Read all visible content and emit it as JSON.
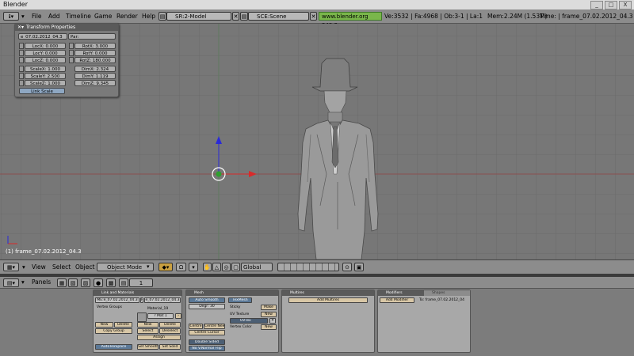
{
  "window": {
    "title": "Blender",
    "controls": [
      "_",
      "□",
      "X"
    ]
  },
  "info_header": {
    "menu": [
      "File",
      "Add",
      "Timeline",
      "Game",
      "Render",
      "Help"
    ],
    "screen": "SR:2-Model",
    "scene": "SCE:Scene",
    "url": "www.blender.org 249.2",
    "stats": "Ve:3532 | Fa:4968 | Ob:3-1 | La:1",
    "mem": "Mem:2.24M (1.53M)",
    "time": "Time: | frame_07.02.2012_04.3"
  },
  "transform_panel": {
    "title": "Transform Properties",
    "object_name": "e_07.02.2012_04.3",
    "parent": "Par:",
    "loc": [
      "LocX: 0.000",
      "LocY: 0.000",
      "LocZ: 0.000"
    ],
    "rot": [
      "RotX: 3.000",
      "RotY: 0.000",
      "RotZ: 180.000"
    ],
    "scale": [
      "ScaleX: 1.000",
      "ScaleY: 2.500",
      "ScaleZ: 1.000"
    ],
    "dim": [
      "DimX: 2.324",
      "DimY: 1.119",
      "DimZ: 9.345"
    ],
    "link_scale": "Link Scale"
  },
  "viewport": {
    "frame_label": "(1) frame_07.02.2012_04.3"
  },
  "view3d_header": {
    "menu": [
      "View",
      "Select",
      "Object"
    ],
    "mode": "Object Mode",
    "orientation": "Global"
  },
  "buttons_window": {
    "panels_label": "Panels",
    "page": "1",
    "link_materials": {
      "title": "Link and Materials",
      "me": "ME:e_07.02.2012_04.3",
      "f": "F",
      "ob": "e_07.02.2012_04.3",
      "vertex_groups": "Vertex Groups",
      "material": "Material_19",
      "mat_count": "? Mat 1",
      "new1": "New",
      "delete1": "Delete",
      "copy_group": "Copy Group",
      "new2": "New",
      "delete2": "Delete",
      "select": "Select",
      "deselect": "Deselect",
      "assign": "Assign",
      "autotexspace": "AutoTexSpace",
      "set_smooth": "Set Smooth",
      "set_solid": "Set Solid"
    },
    "mesh": {
      "title": "Mesh",
      "auto_smooth": "Auto Smooth",
      "degr": "Degr: 30",
      "centre": "Centre",
      "centre_new": "Centre New",
      "centre_cursor": "Centre Cursor",
      "double_sided": "Double Sided",
      "no_v_normal_flip": "No V.Normal Flip",
      "texmesh": "TexMesh",
      "sticky": "Sticky",
      "make": "Make",
      "uv_texture": "UV Texture",
      "new_uv": "New",
      "uvtex": "UVTex",
      "vertex_color": "Vertex Color",
      "new_vc": "New"
    },
    "multires": {
      "title": "Multires",
      "add": "Add Multires"
    },
    "modifiers": {
      "title": "Modifiers",
      "shapes": "Shapes",
      "add": "Add Modifier",
      "to": "To: frame_07.02.2012_04"
    }
  }
}
